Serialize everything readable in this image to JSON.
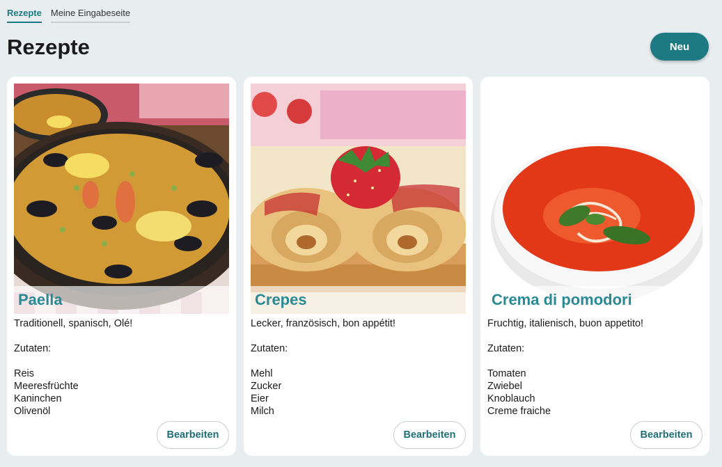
{
  "tabs": [
    {
      "label": "Rezepte",
      "active": true
    },
    {
      "label": "Meine Eingabeseite",
      "active": false
    }
  ],
  "page": {
    "title": "Rezepte",
    "new_label": "Neu"
  },
  "colors": {
    "accent": "#1e7a82",
    "background": "#e8edf0",
    "card_title": "#2a8a93"
  },
  "recipes": [
    {
      "title": "Paella",
      "description": "Traditionell, spanisch, Olé!",
      "zutaten_label": "Zutaten:",
      "ingredients": [
        "Reis",
        "Meeresfrüchte",
        "Kaninchen",
        "Olivenöl"
      ],
      "edit_label": "Bearbeiten"
    },
    {
      "title": "Crepes",
      "description": "Lecker, französisch, bon appétit!",
      "zutaten_label": "Zutaten:",
      "ingredients": [
        "Mehl",
        "Zucker",
        "Eier",
        "Milch"
      ],
      "edit_label": "Bearbeiten"
    },
    {
      "title": "Crema di pomodori",
      "description": "Fruchtig, italienisch, buon appetito!",
      "zutaten_label": "Zutaten:",
      "ingredients": [
        "Tomaten",
        "Zwiebel",
        "Knoblauch",
        "Creme fraiche"
      ],
      "edit_label": "Bearbeiten"
    }
  ]
}
